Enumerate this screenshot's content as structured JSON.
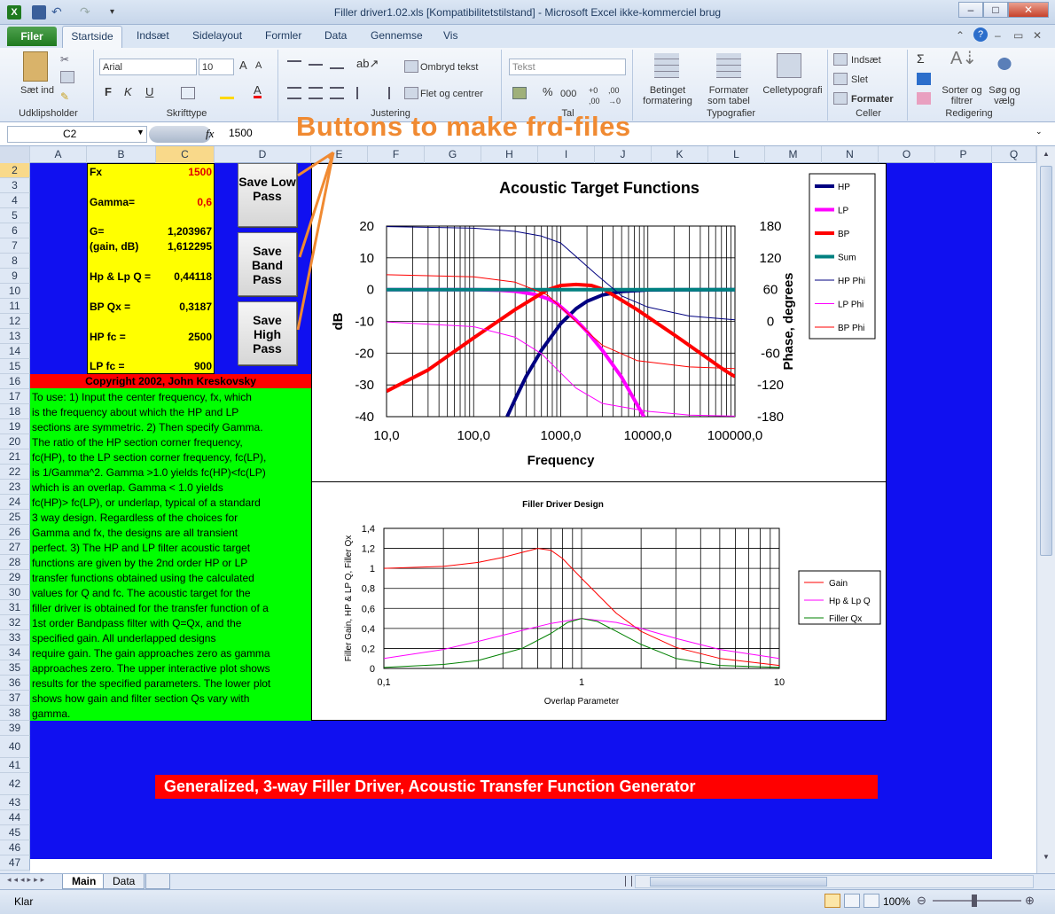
{
  "window": {
    "title": "Filler driver1.02.xls  [Kompatibilitetstilstand]  -  Microsoft Excel ikke-kommerciel brug"
  },
  "ribbon": {
    "file_tab": "Filer",
    "tabs": [
      "Startside",
      "Indsæt",
      "Sidelayout",
      "Formler",
      "Data",
      "Gennemse",
      "Vis"
    ],
    "paste": "Sæt ind",
    "font_name": "Arial",
    "font_size": "10",
    "wrap_text": "Ombryd tekst",
    "merge_center": "Flet og centrer",
    "number_format": "Tekst",
    "conditional_formatting": "Betinget formatering",
    "format_as_table": "Formater som tabel",
    "cell_styles": "Celletypografi",
    "insert": "Indsæt",
    "delete": "Slet",
    "format": "Formater",
    "sort_filter": "Sorter og filtrer",
    "find_select": "Søg og vælg",
    "groups": {
      "clipboard": "Udklipsholder",
      "font": "Skrifttype",
      "alignment": "Justering",
      "number": "Tal",
      "styles": "Typografier",
      "cells": "Celler",
      "editing": "Redigering"
    },
    "bold": "F",
    "italic": "K",
    "underline": "U",
    "percent": "%",
    "thousands": "000"
  },
  "formula_bar": {
    "name_box": "C2",
    "fx": "fx",
    "value": "1500"
  },
  "annotation": "Buttons to make frd-files",
  "columns": [
    "A",
    "B",
    "C",
    "D",
    "E",
    "F",
    "G",
    "H",
    "I",
    "J",
    "K",
    "L",
    "M",
    "N",
    "O",
    "P",
    "Q"
  ],
  "rows": [
    "2",
    "3",
    "4",
    "5",
    "6",
    "7",
    "8",
    "9",
    "10",
    "11",
    "12",
    "13",
    "14",
    "15",
    "16",
    "17",
    "18",
    "19",
    "20",
    "21",
    "22",
    "23",
    "24",
    "25",
    "26",
    "27",
    "28",
    "29",
    "30",
    "31",
    "32",
    "33",
    "34",
    "35",
    "36",
    "37",
    "38",
    "39",
    "40",
    "41",
    "42",
    "43",
    "44",
    "45",
    "46",
    "47"
  ],
  "params": [
    {
      "label": "Fx",
      "value": "1500",
      "red": true
    },
    {
      "label": "Gamma=",
      "value": "0,6",
      "red": true
    },
    {
      "label": "G=",
      "value": "1,203967",
      "red": false
    },
    {
      "label": "(gain, dB)",
      "value": "1,612295",
      "red": false
    },
    {
      "label": "Hp & Lp Q =",
      "value": "0,44118",
      "red": false
    },
    {
      "label": "BP Qx =",
      "value": "0,3187",
      "red": false
    },
    {
      "label": "HP fc =",
      "value": "2500",
      "red": false
    },
    {
      "label": "LP fc =",
      "value": "900",
      "red": false
    }
  ],
  "buttons": {
    "lowpass": "Save Low Pass",
    "bandpass": "Save Band Pass",
    "highpass": "Save High Pass"
  },
  "copyright": "Copyright 2002, John Kreskovsky",
  "instructions": [
    "To use: 1) Input the center frequency, fx, which",
    "is the frequency about which the HP and LP",
    "sections are symmetric. 2) Then specify Gamma.",
    "The ratio of the HP section corner frequency,",
    "fc(HP), to the LP section corner frequency, fc(LP),",
    "is 1/Gamma^2. Gamma >1.0 yields fc(HP)<fc(LP)",
    "which is an overlap. Gamma < 1.0 yields",
    "fc(HP)> fc(LP), or underlap, typical of a standard",
    "3 way design. Regardless of the choices for",
    "Gamma and fx, the designs are all transient",
    "perfect. 3) The HP and LP filter acoustic target",
    "functions are given by the 2nd order HP or LP",
    "transfer functions obtained using the calculated",
    "values for Q and fc. The acoustic target for the",
    "filler driver is obtained for the transfer function of a",
    "1st order Bandpass filter with Q=Qx, and the",
    "specified gain.   All underlapped designs",
    "require gain. The gain approaches zero as gamma",
    "approaches zero. The upper interactive plot shows",
    "results for the specified parameters. The lower plot",
    "shows how gain and filter section Qs vary with",
    "gamma."
  ],
  "banner": "Generalized, 3-way Filler Driver, Acoustic Transfer Function Generator",
  "sheet_tabs": [
    "Main",
    "Data"
  ],
  "status": {
    "ready": "Klar",
    "zoom": "100%"
  },
  "colors": {
    "hp": "#000080",
    "lp": "#ff00ff",
    "bp": "#ff0000",
    "sum": "#008080",
    "sheet_bg": "#1010f0",
    "params_bg": "#ffff00",
    "text_bg": "#00ff00"
  },
  "chart_data": [
    {
      "type": "line",
      "title": "Acoustic Target Functions",
      "xlabel": "Frequency",
      "ylabel": "dB",
      "y2label": "Phase, degrees",
      "xscale": "log",
      "xlim": [
        10,
        100000
      ],
      "ylim": [
        -40,
        20
      ],
      "y2lim": [
        -180,
        180
      ],
      "xticks": [
        "10,0",
        "100,0",
        "1000,0",
        "10000,0",
        "100000,0"
      ],
      "yticks": [
        "20",
        "10",
        "0",
        "-10",
        "-20",
        "-30",
        "-40"
      ],
      "y2ticks": [
        "180",
        "120",
        "60",
        "0",
        "-60",
        "-120",
        "-180"
      ],
      "legend_position": "right",
      "grid": true,
      "series": [
        {
          "name": "HP",
          "axis": "left",
          "width": 4,
          "x": [
            242,
            300,
            400,
            600,
            1000,
            1500,
            2000,
            3000,
            5000,
            10000,
            100000
          ],
          "y": [
            -40,
            -34.5,
            -27.4,
            -19.1,
            -10.7,
            -6.0,
            -3.7,
            -1.7,
            -0.6,
            -0.1,
            0
          ]
        },
        {
          "name": "LP",
          "axis": "left",
          "width": 4,
          "x": [
            10,
            100,
            200,
            300,
            500,
            700,
            900,
            1500,
            2000,
            3000,
            5000,
            9000
          ],
          "y": [
            0,
            0,
            -0.2,
            -0.5,
            -1.5,
            -2.8,
            -4.3,
            -9.6,
            -13.2,
            -19.1,
            -27.6,
            -40
          ]
        },
        {
          "name": "BP",
          "axis": "left",
          "width": 4,
          "x": [
            10,
            30,
            100,
            300,
            700,
            1000,
            1500,
            2250,
            3200,
            7500,
            22500,
            75000,
            100000
          ],
          "y": [
            -32.0,
            -25.3,
            -15.2,
            -6.3,
            -0.1,
            1.3,
            1.6,
            1.3,
            -0.1,
            -6.3,
            -15.2,
            -25.3,
            -27.4
          ]
        },
        {
          "name": "Sum",
          "axis": "left",
          "width": 4,
          "x": [
            10,
            100000
          ],
          "y": [
            0,
            0
          ]
        },
        {
          "name": "HP Phi",
          "axis": "right",
          "width": 1,
          "x": [
            10,
            100,
            300,
            600,
            1000,
            2500,
            5000,
            10000,
            30000,
            100000
          ],
          "y": [
            179,
            176,
            170,
            161,
            148,
            90,
            48,
            27,
            10,
            3
          ]
        },
        {
          "name": "LP Phi",
          "axis": "right",
          "width": 1,
          "x": [
            10,
            100,
            300,
            600,
            900,
            1500,
            3000,
            10000,
            30000,
            100000
          ],
          "y": [
            -1,
            -10,
            -30,
            -61,
            -90,
            -126,
            -155,
            -170,
            -177,
            -179
          ]
        },
        {
          "name": "BP Phi",
          "axis": "right",
          "width": 1,
          "x": [
            10,
            100,
            300,
            700,
            1500,
            3000,
            7500,
            30000,
            100000
          ],
          "y": [
            88,
            84,
            74,
            50,
            0,
            -45,
            -74,
            -86,
            -89
          ]
        }
      ]
    },
    {
      "type": "line",
      "title": "Filler Driver Design",
      "xlabel": "Overlap Parameter",
      "ylabel": "Filler Gain, HP & LP Q, Filler Qx",
      "xscale": "log",
      "xlim": [
        0.1,
        10
      ],
      "ylim": [
        0,
        1.4
      ],
      "xticks": [
        "0,1",
        "1",
        "10"
      ],
      "yticks": [
        "1,4",
        "1,2",
        "1",
        "0,8",
        "0,6",
        "0,4",
        "0,2",
        "0"
      ],
      "legend_position": "right",
      "grid": true,
      "series": [
        {
          "name": "Gain",
          "x": [
            0.1,
            0.2,
            0.3,
            0.4,
            0.5,
            0.6,
            0.7,
            0.8,
            1,
            1.5,
            2,
            3,
            5,
            10
          ],
          "y": [
            1.0,
            1.02,
            1.06,
            1.11,
            1.16,
            1.2,
            1.18,
            1.1,
            0.9,
            0.55,
            0.37,
            0.21,
            0.1,
            0.03
          ]
        },
        {
          "name": "Hp & Lp Q",
          "x": [
            0.1,
            0.2,
            0.3,
            0.5,
            0.7,
            1,
            1.5,
            2,
            3,
            5,
            10
          ],
          "y": [
            0.1,
            0.19,
            0.27,
            0.38,
            0.45,
            0.5,
            0.46,
            0.4,
            0.3,
            0.19,
            0.1
          ]
        },
        {
          "name": "Filler Qx",
          "x": [
            0.1,
            0.2,
            0.3,
            0.5,
            0.7,
            0.85,
            1,
            1.2,
            1.5,
            2,
            3,
            5,
            10
          ],
          "y": [
            0.01,
            0.04,
            0.08,
            0.2,
            0.35,
            0.46,
            0.5,
            0.47,
            0.37,
            0.24,
            0.1,
            0.03,
            0.01
          ]
        }
      ]
    }
  ]
}
